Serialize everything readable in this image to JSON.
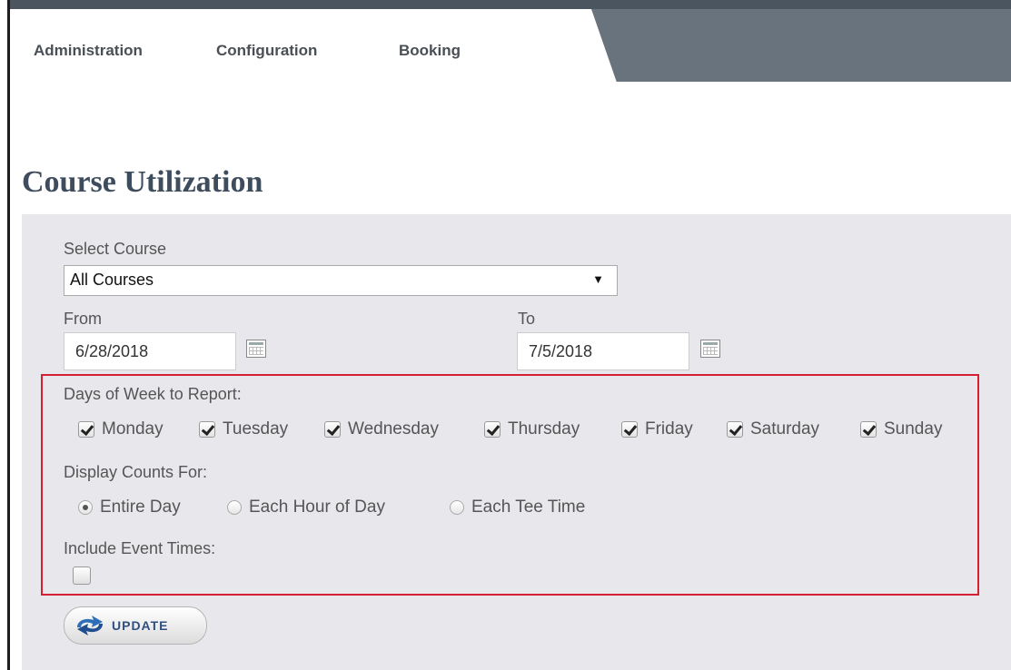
{
  "nav": {
    "tabs": [
      {
        "label": "Administration"
      },
      {
        "label": "Configuration"
      },
      {
        "label": "Booking"
      }
    ]
  },
  "page": {
    "title": "Course Utilization"
  },
  "form": {
    "select_course": {
      "label": "Select Course",
      "value": "All Courses"
    },
    "from": {
      "label": "From",
      "value": "6/28/2018"
    },
    "to": {
      "label": "To",
      "value": "7/5/2018"
    },
    "days_label": "Days of Week to Report:",
    "days": [
      {
        "label": "Monday",
        "checked": true
      },
      {
        "label": "Tuesday",
        "checked": true
      },
      {
        "label": "Wednesday",
        "checked": true
      },
      {
        "label": "Thursday",
        "checked": true
      },
      {
        "label": "Friday",
        "checked": true
      },
      {
        "label": "Saturday",
        "checked": true
      },
      {
        "label": "Sunday",
        "checked": true
      }
    ],
    "counts_label": "Display Counts For:",
    "counts": [
      {
        "label": "Entire Day",
        "selected": true
      },
      {
        "label": "Each Hour of Day",
        "selected": false
      },
      {
        "label": "Each Tee Time",
        "selected": false
      }
    ],
    "event_label": "Include Event Times:",
    "event_checked": false,
    "update_label": "UPDATE"
  },
  "colors": {
    "highlight": "#d51f33",
    "title": "#3e4d5e",
    "nav_dark": "#68737d",
    "update_text": "#2f4f82"
  }
}
